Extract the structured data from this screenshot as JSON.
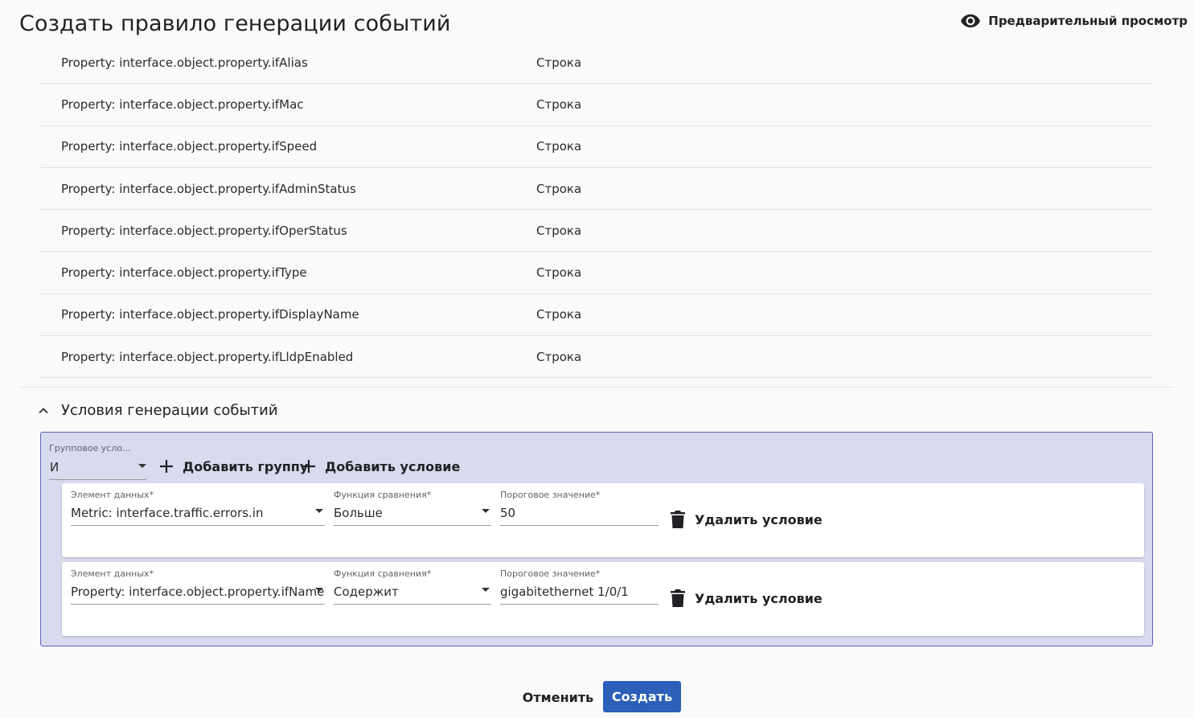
{
  "header": {
    "title": "Создать правило генерации событий",
    "preview_label": "Предварительный просмотр"
  },
  "properties": [
    {
      "name": "Property: interface.object.property.ifAlias",
      "type": "Строка"
    },
    {
      "name": "Property: interface.object.property.ifMac",
      "type": "Строка"
    },
    {
      "name": "Property: interface.object.property.ifSpeed",
      "type": "Строка"
    },
    {
      "name": "Property: interface.object.property.ifAdminStatus",
      "type": "Строка"
    },
    {
      "name": "Property: interface.object.property.ifOperStatus",
      "type": "Строка"
    },
    {
      "name": "Property: interface.object.property.ifType",
      "type": "Строка"
    },
    {
      "name": "Property: interface.object.property.ifDisplayName",
      "type": "Строка"
    },
    {
      "name": "Property: interface.object.property.ifLldpEnabled",
      "type": "Строка"
    }
  ],
  "conditions_section": {
    "title": "Условия генерации событий",
    "group_condition": {
      "label": "Групповое усло...",
      "value": "И"
    },
    "add_group_label": "Добавить группу",
    "add_condition_label": "Добавить условие",
    "conditions": [
      {
        "element_label": "Элемент данных*",
        "element_value": "Metric: interface.traffic.errors.in",
        "function_label": "Функция сравнения*",
        "function_value": "Больше",
        "threshold_label": "Пороговое значение*",
        "threshold_value": "50",
        "delete_label": "Удалить условие"
      },
      {
        "element_label": "Элемент данных*",
        "element_value": "Property: interface.object.property.ifName",
        "function_label": "Функция сравнения*",
        "function_value": "Содержит",
        "threshold_label": "Пороговое значение*",
        "threshold_value": "gigabitethernet 1/0/1",
        "delete_label": "Удалить условие"
      }
    ]
  },
  "footer": {
    "cancel_label": "Отменить",
    "create_label": "Создать",
    "create_color": "#2b5fb8"
  },
  "icons": {
    "preview": "eye-icon",
    "section_toggle": "chevron-up-icon",
    "add": "plus-icon",
    "delete": "trash-icon"
  }
}
